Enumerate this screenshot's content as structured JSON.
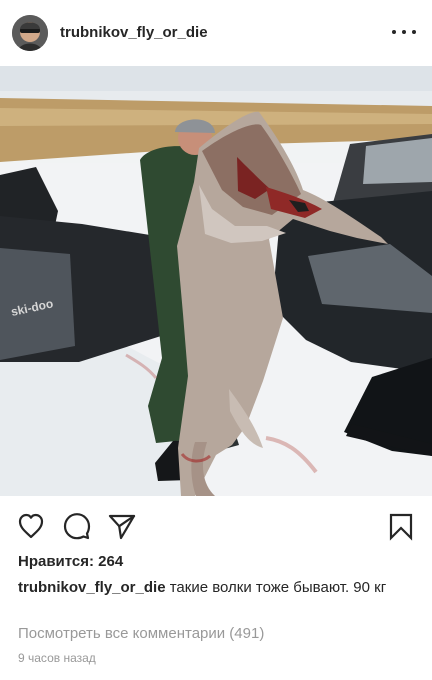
{
  "post": {
    "username": "trubnikov_fly_or_die",
    "likes_text": "Нравится: 264",
    "caption_user": "trubnikov_fly_or_die",
    "caption_text": "такие волки тоже бывают. 90 кг",
    "view_comments": "Посмотреть все комментарии (491)",
    "time_ago": "9 часов назад"
  },
  "icons": {
    "like": "heart-icon",
    "comment": "comment-icon",
    "share": "share-icon",
    "save": "bookmark-icon",
    "more": "more-options-icon"
  },
  "colors": {
    "text": "#262626",
    "muted": "#999999"
  }
}
